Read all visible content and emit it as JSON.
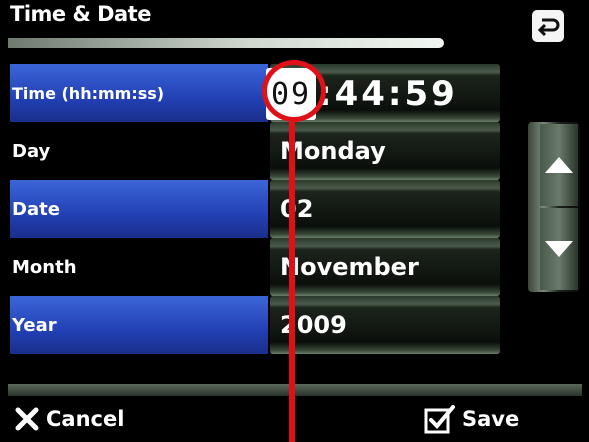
{
  "header": {
    "title": "Time & Date",
    "back_icon": "return-arrow-icon"
  },
  "rows": [
    {
      "label": "Time (hh:mm:ss)",
      "hour": "09",
      "minsec": ":44:59"
    },
    {
      "label": "Day",
      "value": "Monday"
    },
    {
      "label": "Date",
      "value": "02"
    },
    {
      "label": "Month",
      "value": "November"
    },
    {
      "label": "Year",
      "value": "2009"
    }
  ],
  "scroll": {
    "up_icon": "triangle-up-icon",
    "down_icon": "triangle-down-icon"
  },
  "footer": {
    "cancel_label": "Cancel",
    "save_label": "Save",
    "cancel_icon": "x-icon",
    "save_icon": "checkbox-check-icon"
  },
  "colors": {
    "label_blue": "#2a4fc8",
    "annotation_red": "#e01018",
    "background": "#000000"
  }
}
